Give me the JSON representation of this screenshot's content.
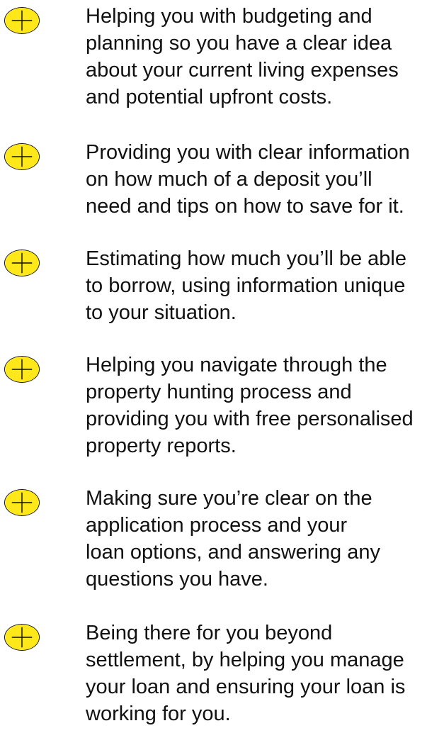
{
  "colors": {
    "icon_fill": "#FFE81A",
    "icon_stroke": "#111111",
    "text": "#111111",
    "background": "#FFFFFF"
  },
  "list": {
    "icon": "plus-circle-icon",
    "items": [
      {
        "text": "Helping you with budgeting and\nplanning so you have a clear idea\nabout your current living expenses\nand potential upfront costs."
      },
      {
        "text": "Providing you with clear information\non how much of a deposit you’ll\nneed and tips on how to save for it."
      },
      {
        "text": "Estimating how much you’ll be able\nto borrow, using information unique\nto your situation."
      },
      {
        "text": "Helping you navigate through the\nproperty hunting process and\nproviding you with free personalised\nproperty reports."
      },
      {
        "text": "Making sure you’re clear on the\napplication process and your\nloan options, and answering any\nquestions you have."
      },
      {
        "text": "Being there for you beyond\nsettlement, by helping you manage\nyour loan and ensuring your loan is\nworking for you."
      }
    ]
  }
}
